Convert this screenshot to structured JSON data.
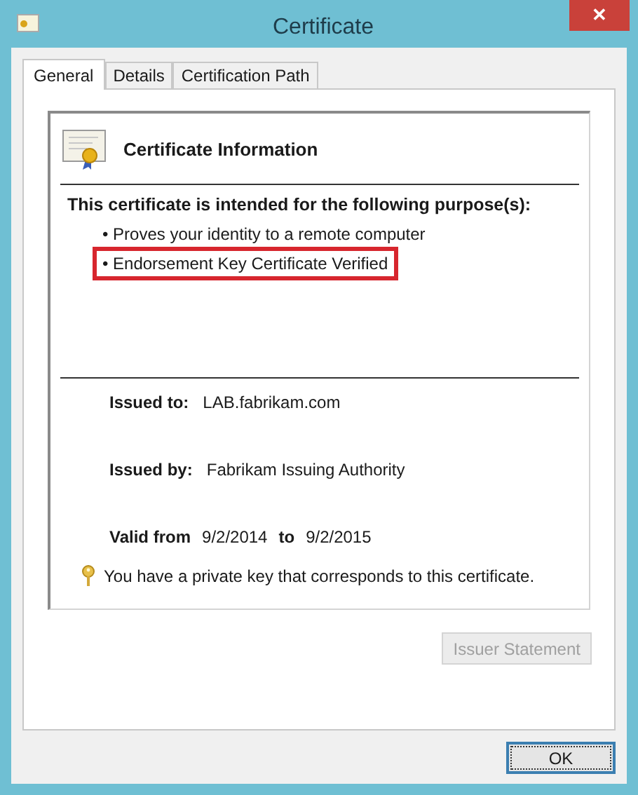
{
  "window": {
    "title": "Certificate",
    "close": "✕"
  },
  "tabs": [
    {
      "label": "General",
      "selected": true
    },
    {
      "label": "Details",
      "selected": false
    },
    {
      "label": "Certification Path",
      "selected": false
    }
  ],
  "info": {
    "heading": "Certificate Information",
    "purpose_heading": "This certificate is intended for the following purpose(s):",
    "purposes": [
      {
        "text": "• Proves your identity to a remote computer",
        "highlighted": false
      },
      {
        "text": "• Endorsement Key Certificate Verified",
        "highlighted": true
      }
    ],
    "issued_to": {
      "label": "Issued to:",
      "value": "LAB.fabrikam.com"
    },
    "issued_by": {
      "label": "Issued by:",
      "value": "Fabrikam Issuing Authority"
    },
    "valid": {
      "from_label": "Valid from",
      "from": "9/2/2014",
      "to_label": "to",
      "to": "9/2/2015"
    },
    "private_key_note": "You have a private key that corresponds to this certificate."
  },
  "issuer_statement": {
    "label": "Issuer Statement",
    "disabled": true
  },
  "ok_button": {
    "label": "OK"
  }
}
